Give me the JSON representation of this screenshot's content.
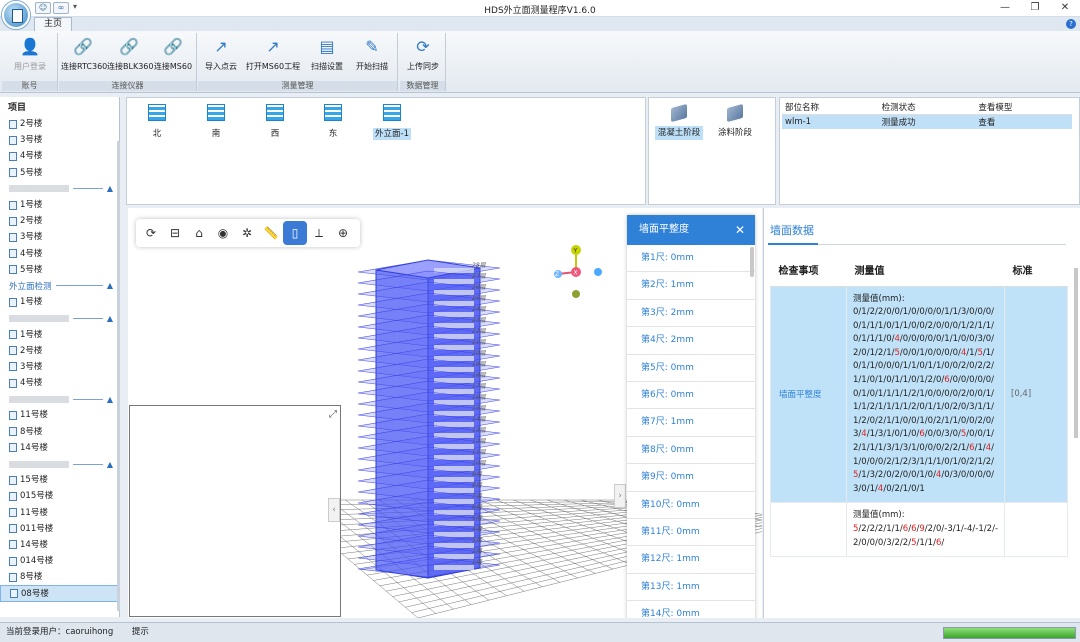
{
  "window": {
    "title": "HDS外立面测量程序V1.6.0",
    "min": "—",
    "max": "❐",
    "close": "✕"
  },
  "tabs": {
    "home": "主页"
  },
  "ribbon": {
    "groups": [
      {
        "label": "账号",
        "buttons": [
          {
            "label": "用户登录",
            "icon": "user-icon",
            "disabled": true
          }
        ]
      },
      {
        "label": "连接仪器",
        "buttons": [
          {
            "label": "连接RTC360",
            "icon": "link-icon"
          },
          {
            "label": "连接BLK360",
            "icon": "link-icon"
          },
          {
            "label": "连接MS60",
            "icon": "link-icon"
          }
        ]
      },
      {
        "label": "测量管理",
        "buttons": [
          {
            "label": "导入点云",
            "icon": "import-icon"
          },
          {
            "label": "打开MS60工程",
            "icon": "open-project-icon"
          },
          {
            "label": "扫描设置",
            "icon": "settings-doc-icon"
          },
          {
            "label": "开始扫描",
            "icon": "pen-icon"
          }
        ]
      },
      {
        "label": "数据管理",
        "buttons": [
          {
            "label": "上传同步",
            "icon": "sync-icon"
          }
        ]
      }
    ]
  },
  "tree": {
    "root": "项目",
    "items": [
      {
        "type": "item",
        "label": "2号楼"
      },
      {
        "type": "item",
        "label": "3号楼"
      },
      {
        "type": "item",
        "label": "4号楼"
      },
      {
        "type": "item",
        "label": "5号楼"
      },
      {
        "type": "group",
        "label": ""
      },
      {
        "type": "item",
        "label": "1号楼"
      },
      {
        "type": "item",
        "label": "2号楼"
      },
      {
        "type": "item",
        "label": "3号楼"
      },
      {
        "type": "item",
        "label": "4号楼"
      },
      {
        "type": "item",
        "label": "5号楼"
      },
      {
        "type": "group",
        "label": "外立面检测"
      },
      {
        "type": "item",
        "label": "1号楼"
      },
      {
        "type": "group",
        "label": ""
      },
      {
        "type": "item",
        "label": "1号楼"
      },
      {
        "type": "item",
        "label": "2号楼"
      },
      {
        "type": "item",
        "label": "3号楼"
      },
      {
        "type": "item",
        "label": "4号楼"
      },
      {
        "type": "group",
        "label": ""
      },
      {
        "type": "item",
        "label": "11号楼"
      },
      {
        "type": "item",
        "label": "8号楼"
      },
      {
        "type": "item",
        "label": "14号楼"
      },
      {
        "type": "group",
        "label": ""
      },
      {
        "type": "item",
        "label": "15号楼"
      },
      {
        "type": "item",
        "label": "015号楼"
      },
      {
        "type": "item",
        "label": "11号楼"
      },
      {
        "type": "item",
        "label": "011号楼"
      },
      {
        "type": "item",
        "label": "14号楼"
      },
      {
        "type": "item",
        "label": "014号楼"
      },
      {
        "type": "item",
        "label": "8号楼"
      },
      {
        "type": "item",
        "label": "08号楼",
        "selected": true
      }
    ]
  },
  "facades": [
    {
      "label": "北"
    },
    {
      "label": "南"
    },
    {
      "label": "西"
    },
    {
      "label": "东"
    },
    {
      "label": "外立面-1",
      "selected": true
    }
  ],
  "stages": [
    {
      "label": "混凝土阶段",
      "selected": true
    },
    {
      "label": "涂料阶段"
    }
  ],
  "parts": {
    "headers": [
      "部位名称",
      "检测状态",
      "查看模型"
    ],
    "rows": [
      [
        "wlm-1",
        "测量成功",
        "查看"
      ]
    ]
  },
  "viewer": {
    "tools": [
      "refresh-icon",
      "minus-box-icon",
      "home-view-icon",
      "eye-icon",
      "gear-icon",
      "ruler-icon",
      "flatness-icon",
      "axes-icon",
      "target-icon"
    ],
    "floors": [
      "28层",
      "27层",
      "26层",
      "25层",
      "24层",
      "23层",
      "22层",
      "21层",
      "20层",
      "19层",
      "18层",
      "17层",
      "16层",
      "15层",
      "14层",
      "13层",
      "12层",
      "11层",
      "10层",
      "9层",
      "8层",
      "7层",
      "6层",
      "5层",
      "4层",
      "3层",
      "2层",
      "1层"
    ]
  },
  "flatness": {
    "title": "墙面平整度",
    "items": [
      "第1尺: 0mm",
      "第2尺: 1mm",
      "第3尺: 2mm",
      "第4尺: 2mm",
      "第5尺: 0mm",
      "第6尺: 0mm",
      "第7尺: 1mm",
      "第8尺: 0mm",
      "第9尺: 0mm",
      "第10尺: 0mm",
      "第11尺: 0mm",
      "第12尺: 1mm",
      "第13尺: 1mm",
      "第14尺: 0mm"
    ]
  },
  "wall_data": {
    "tab": "墙面数据",
    "headers": [
      "检查事项",
      "测量值",
      "标准"
    ],
    "rows": [
      {
        "item": "墙面平整度",
        "prefix": "测量值(mm):",
        "value": "0/1/2/2/0/0/1/0/0/0/0/1/1/3/0/0/0/0/1/1/1/0/1/1/0/0/2/0/0/0/1/2/1/1/0/1/1/1/0/4/0/0/0/0/0/1/1/0/0/3/0/2/0/1/2/1/5/0/0/1/0/0/0/0/4/1/5/1/0/1/1/0/0/0/1/1/0/1/1/0/0/2/0/2/2/1/1/0/1/0/1/1/0/1/2/0/6/0/0/0/0/0/0/1/0/1/1/1/1/2/1/0/0/0/0/2/0/0/1/1/1/2/1/1/1/1/2/0/1/1/0/2/0/3/1/1/1/2/0/2/1/1/0/0/1/0/2/1/1/0/0/2/0/3/4/1/3/1/0/1/0/6/0/0/3/0/5/0/0/1/2/1/1/1/3/1/3/1/0/0/0/2/2/1/6/1/4/1/0/0/0/2/1/2/3/1/1/1/0/1/0/2/1/2/5/1/3/2/0/2/0/0/1/0/4/0/3/0/0/0/0/3/0/1/4/0/2/1/0/1",
        "red_values": [
          "4",
          "5",
          "6"
        ],
        "standard": "[0,4]"
      },
      {
        "item": "",
        "prefix": "测量值(mm):",
        "value": "5/2/2/2/1/1/6/6/9/2/0/-3/1/-4/-1/2/-2/0/0/0/3/2/2/5/1/1/6/",
        "red_values": [
          "5",
          "6",
          "9"
        ],
        "standard": ""
      }
    ]
  },
  "status": {
    "user_label": "当前登录用户：",
    "user": "caoruihong",
    "hint": "提示",
    "progress": 1.0
  },
  "colors": {
    "accent": "#2f81d8",
    "highlight": "#bfe2f8",
    "building": "#3b49f0"
  }
}
